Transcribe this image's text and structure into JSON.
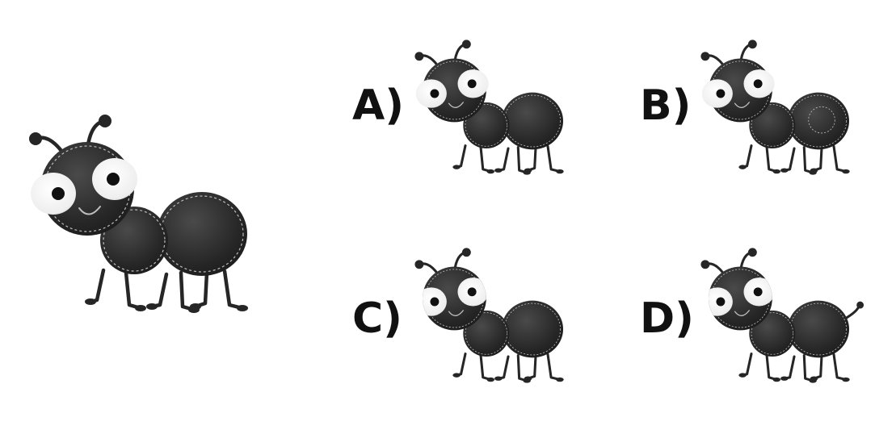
{
  "colors": {
    "body": "#262626",
    "body_highlight": "#4a4a4a",
    "stitch": "#bdbdbd",
    "eye_white": "#f4f4f4",
    "pupil": "#111111",
    "label": "#111111",
    "background": "#ffffff"
  },
  "reference_ant": {
    "description_icon": "ant-icon"
  },
  "options": [
    {
      "key": "A",
      "label": "A)"
    },
    {
      "key": "B",
      "label": "B)"
    },
    {
      "key": "C",
      "label": "C)"
    },
    {
      "key": "D",
      "label": "D)"
    }
  ]
}
